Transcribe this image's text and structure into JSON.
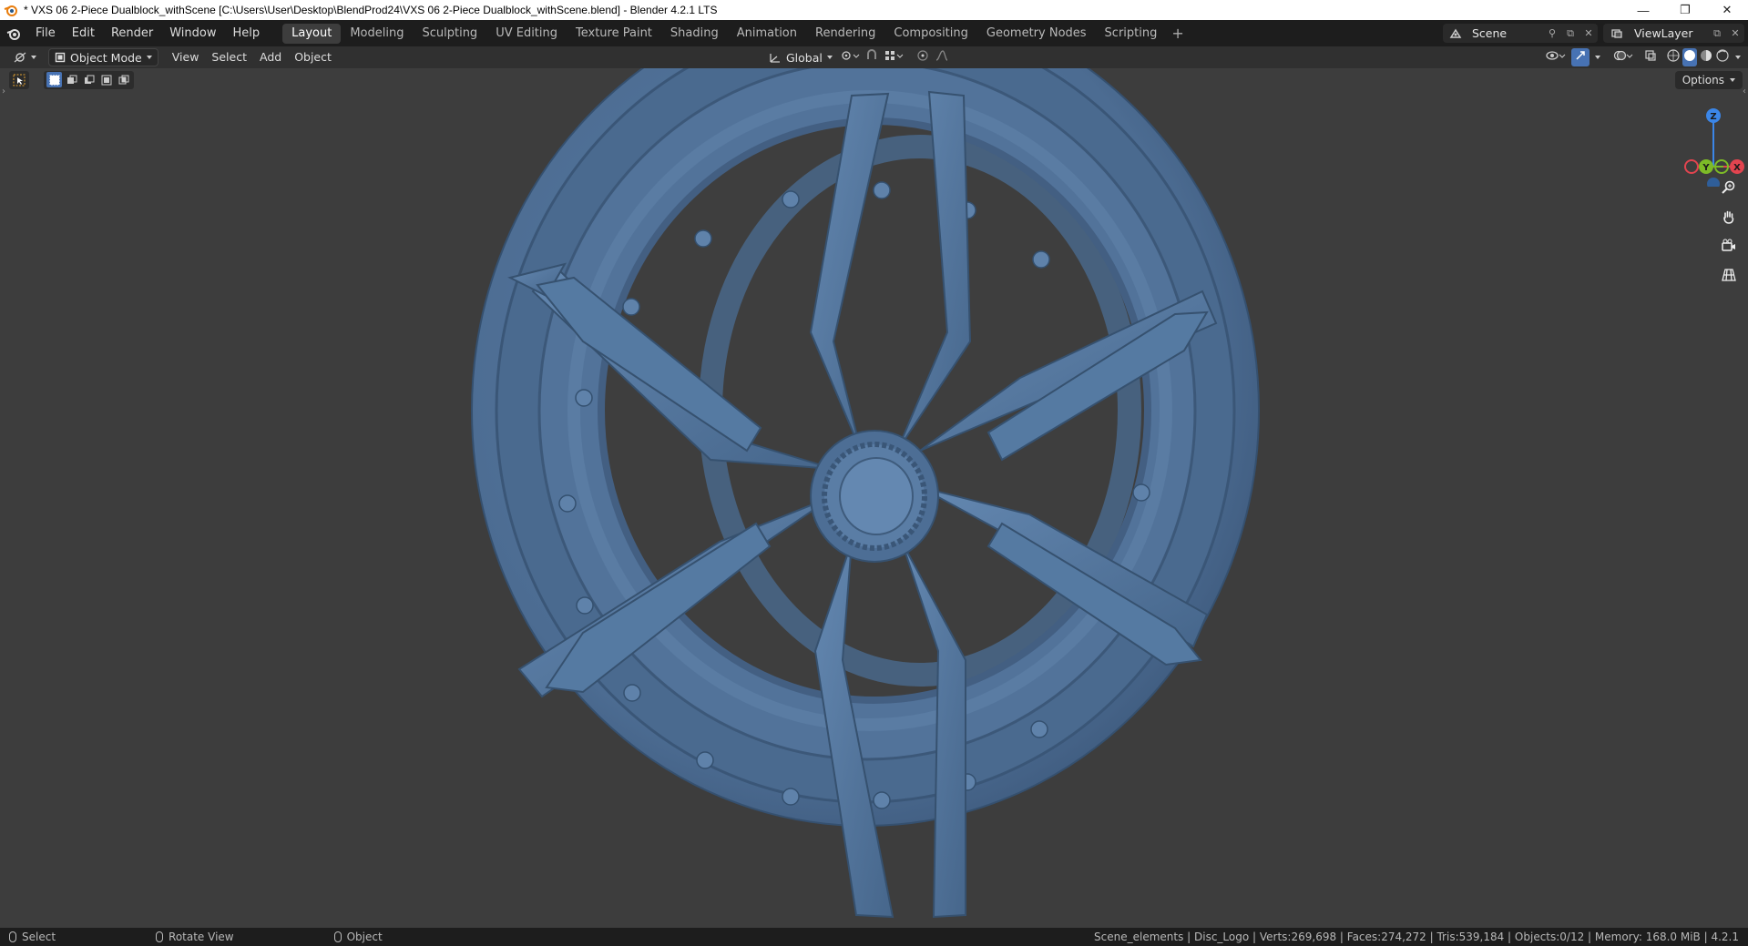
{
  "window": {
    "title": "* VXS 06 2-Piece Dualblock_withScene [C:\\Users\\User\\Desktop\\BlendProd24\\VXS 06 2-Piece Dualblock_withScene.blend] - Blender 4.2.1 LTS",
    "minimize": "—",
    "restore": "❐",
    "close": "✕"
  },
  "menu": {
    "items": [
      "File",
      "Edit",
      "Render",
      "Window",
      "Help"
    ]
  },
  "workspaces": {
    "tabs": [
      "Layout",
      "Modeling",
      "Sculpting",
      "UV Editing",
      "Texture Paint",
      "Shading",
      "Animation",
      "Rendering",
      "Compositing",
      "Geometry Nodes",
      "Scripting"
    ],
    "active": "Layout",
    "add": "+"
  },
  "scene": {
    "name": "Scene"
  },
  "view_layer": {
    "name": "ViewLayer"
  },
  "header": {
    "mode": "Object Mode",
    "view": "View",
    "select": "Select",
    "add": "Add",
    "object": "Object",
    "transform_orientation": "Global"
  },
  "viewport": {
    "options": "Options",
    "gizmo": {
      "z": "Z",
      "y": "Y",
      "x": "X"
    },
    "wheel_color": "#4f6f94"
  },
  "statusbar": {
    "left": [
      "Select",
      "Rotate View",
      "Object"
    ],
    "stats": "Scene_elements | Disc_Logo | Verts:269,698 | Faces:274,272 | Tris:539,184 | Objects:0/12 | Memory: 168.0 MiB | 4.2.1"
  },
  "colors": {
    "accent_blue": "#4772b3",
    "axis_x": "#e2444f",
    "axis_y": "#7dbb27",
    "axis_z": "#3b86e8"
  }
}
